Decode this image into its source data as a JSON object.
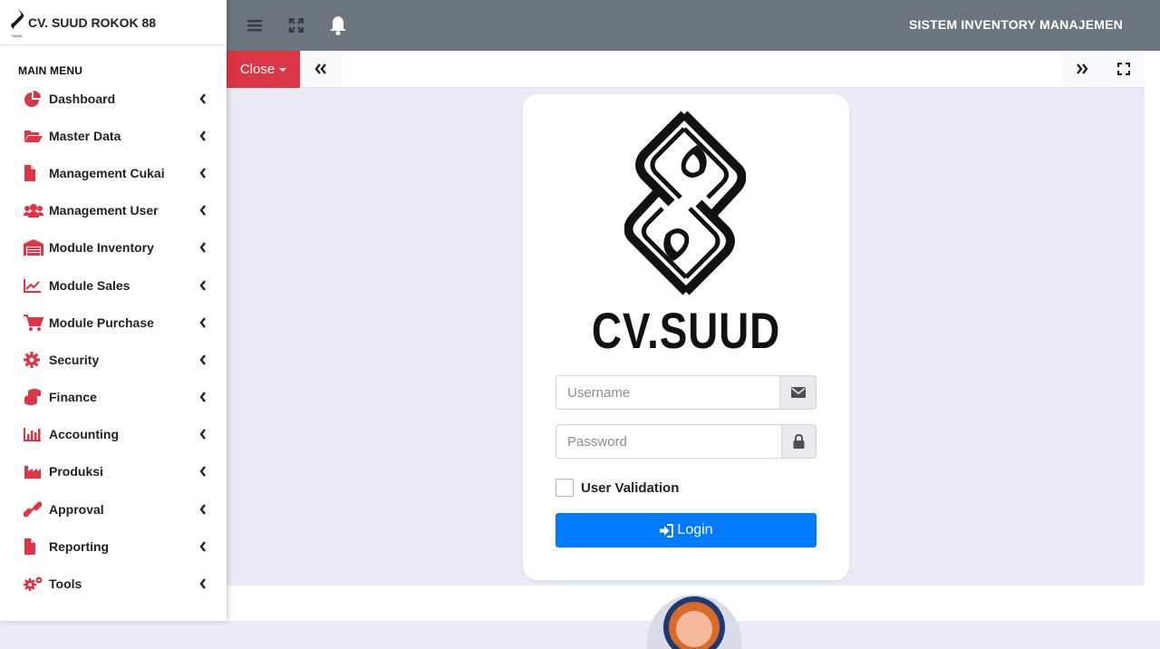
{
  "brand": {
    "name": "CV. SUUD ROKOK 88",
    "logo_caption": "SUUD"
  },
  "sidebar": {
    "header": "MAIN MENU",
    "items": [
      {
        "label": "Dashboard",
        "icon": "pie-chart-icon"
      },
      {
        "label": "Master Data",
        "icon": "folder-open-icon"
      },
      {
        "label": "Management Cukai",
        "icon": "file-icon"
      },
      {
        "label": "Management User",
        "icon": "users-icon"
      },
      {
        "label": "Module Inventory",
        "icon": "warehouse-icon"
      },
      {
        "label": "Module Sales",
        "icon": "line-chart-icon"
      },
      {
        "label": "Module Purchase",
        "icon": "cart-icon"
      },
      {
        "label": "Security",
        "icon": "gear-icon"
      },
      {
        "label": "Finance",
        "icon": "coins-icon"
      },
      {
        "label": "Accounting",
        "icon": "bar-chart-icon"
      },
      {
        "label": "Produksi",
        "icon": "industry-icon"
      },
      {
        "label": "Approval",
        "icon": "link-icon"
      },
      {
        "label": "Reporting",
        "icon": "file-icon"
      },
      {
        "label": "Tools",
        "icon": "gears-icon"
      }
    ]
  },
  "topbar": {
    "title": "SISTEM INVENTORY MANAJEMEN"
  },
  "tabbar": {
    "close_label": "Close"
  },
  "login": {
    "logo_text": "CV.SUUD",
    "username_placeholder": "Username",
    "password_placeholder": "Password",
    "validation_label": "User Validation",
    "button_label": "Login"
  },
  "colors": {
    "accent_red": "#dc3545",
    "primary": "#007bff",
    "topbar": "#6c757d",
    "icon_red": "#dc3545"
  }
}
